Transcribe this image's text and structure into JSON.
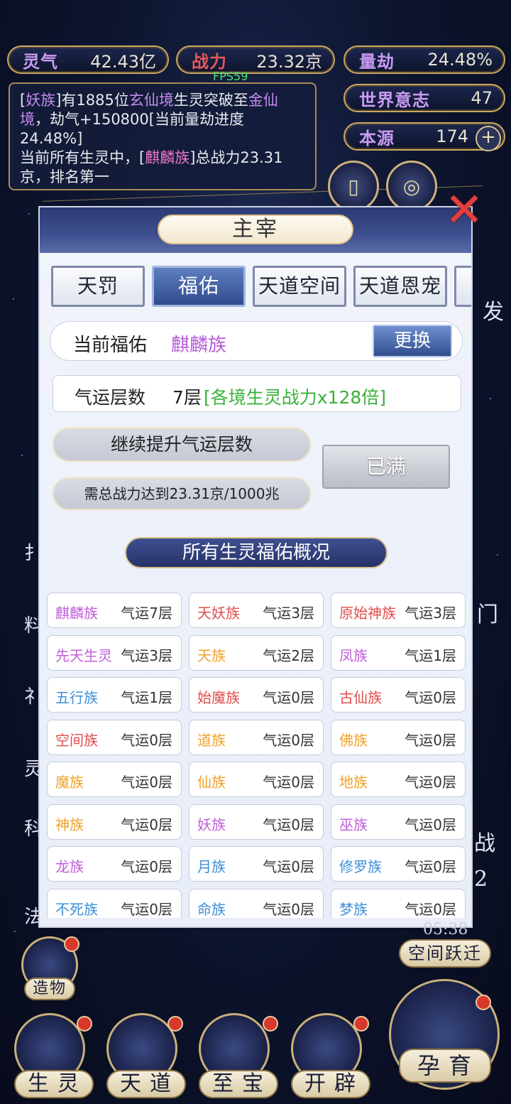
{
  "stats": {
    "lingqi": {
      "label": "灵气",
      "value": "42.43亿"
    },
    "zhanli": {
      "label": "战力",
      "value": "23.32京"
    },
    "liangjie": {
      "label": "量劫",
      "value": "24.48%"
    },
    "shijie": {
      "label": "世界意志",
      "value": "47"
    },
    "benyuan": {
      "label": "本源",
      "value": "174"
    }
  },
  "fps": "FPS59",
  "log": {
    "line1_a": "[",
    "race1": "妖族",
    "line1_b": "]有1885位",
    "realm1": "玄仙境",
    "line1_c": "生灵突破至",
    "realm2": "金仙境",
    "line1_d": "，劫气+150800[当前量劫进度24.48%]",
    "line2_a": "当前所有生灵中，[",
    "race2": "麒麟族",
    "line2_b": "]总战力23.31京，排名第一"
  },
  "panel": {
    "title": "主宰",
    "tabs": [
      "天罚",
      "福佑",
      "天道空间",
      "天道恩宠"
    ],
    "current_label": "当前福佑",
    "current_value": "麒麟族",
    "swap_label": "更换",
    "luck_label": "气运层数",
    "luck_value": "7层",
    "luck_bonus": "[各境生灵战力x128倍]",
    "upgrade_label": "继续提升气运层数",
    "requirement": "需总战力达到23.31京/1000兆",
    "full_label": "已满",
    "section_title": "所有生灵福佑概况"
  },
  "races": [
    {
      "name": "麒麟族",
      "level": "气运7层",
      "color": "#c05fd8"
    },
    {
      "name": "天妖族",
      "level": "气运3层",
      "color": "#e04d4d"
    },
    {
      "name": "原始神族",
      "level": "气运3层",
      "color": "#e04d4d"
    },
    {
      "name": "先天生灵",
      "level": "气运3层",
      "color": "#c05fd8"
    },
    {
      "name": "天族",
      "level": "气运2层",
      "color": "#f0a12a"
    },
    {
      "name": "凤族",
      "level": "气运1层",
      "color": "#c05fd8"
    },
    {
      "name": "五行族",
      "level": "气运1层",
      "color": "#3e8fd8"
    },
    {
      "name": "始魔族",
      "level": "气运0层",
      "color": "#e04d4d"
    },
    {
      "name": "古仙族",
      "level": "气运0层",
      "color": "#e04d4d"
    },
    {
      "name": "空间族",
      "level": "气运0层",
      "color": "#e04d4d"
    },
    {
      "name": "道族",
      "level": "气运0层",
      "color": "#f0a12a"
    },
    {
      "name": "佛族",
      "level": "气运0层",
      "color": "#f0a12a"
    },
    {
      "name": "魔族",
      "level": "气运0层",
      "color": "#f0a12a"
    },
    {
      "name": "仙族",
      "level": "气运0层",
      "color": "#f0a12a"
    },
    {
      "name": "地族",
      "level": "气运0层",
      "color": "#f0a12a"
    },
    {
      "name": "神族",
      "level": "气运0层",
      "color": "#f0a12a"
    },
    {
      "name": "妖族",
      "level": "气运0层",
      "color": "#c05fd8"
    },
    {
      "name": "巫族",
      "level": "气运0层",
      "color": "#c05fd8"
    },
    {
      "name": "龙族",
      "level": "气运0层",
      "color": "#c05fd8"
    },
    {
      "name": "月族",
      "level": "气运0层",
      "color": "#3e8fd8"
    },
    {
      "name": "修罗族",
      "level": "气运0层",
      "color": "#3e8fd8"
    },
    {
      "name": "不死族",
      "level": "气运0层",
      "color": "#3e8fd8"
    },
    {
      "name": "命族",
      "level": "气运0层",
      "color": "#3e8fd8"
    },
    {
      "name": "梦族",
      "level": "气运0层",
      "color": "#3e8fd8"
    }
  ],
  "side": {
    "right_fa": "发",
    "right_men": "门",
    "right_zhan": "战",
    "right_num": "2",
    "timer": "05:38",
    "space_jump": "空间跃迁",
    "left_chars": [
      "扌",
      "料",
      "礻",
      "灵",
      "科",
      "法"
    ]
  },
  "bottom": {
    "zaowu": "造物",
    "shengling": "生灵",
    "tiandao": "天道",
    "zhibao": "至宝",
    "kaipi": "开辟",
    "yunyu": "孕育"
  }
}
